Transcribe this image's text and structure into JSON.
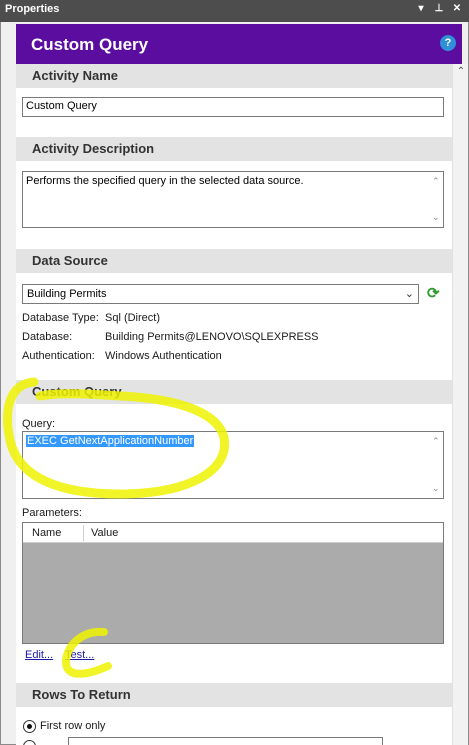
{
  "pane": {
    "title": "Properties",
    "controls": [
      "▾",
      "ᵖ",
      "✕"
    ]
  },
  "header": {
    "title": "Custom Query",
    "help_icon": "?"
  },
  "sections": {
    "activity_name": {
      "heading": "Activity Name",
      "value": "Custom Query"
    },
    "activity_description": {
      "heading": "Activity Description",
      "value": "Performs the specified query in the selected data source."
    },
    "data_source": {
      "heading": "Data Source",
      "selected": "Building Permits",
      "details": [
        {
          "key": "Database Type:",
          "value": "Sql (Direct)"
        },
        {
          "key": "Database:",
          "value": "Building Permits@LENOVO\\SQLEXPRESS"
        },
        {
          "key": "Authentication:",
          "value": "Windows Authentication"
        }
      ]
    },
    "custom_query": {
      "heading": "Custom Query",
      "query_label": "Query:",
      "query_text": "EXEC GetNextApplicationNumber",
      "parameters_label": "Parameters:",
      "columns": [
        "Name",
        "Value"
      ],
      "edit_link": "Edit...",
      "test_link": "Test..."
    },
    "rows_to_return": {
      "heading": "Rows To Return",
      "option_first": "First row only"
    }
  },
  "colors": {
    "header_purple": "#5a0d9e",
    "highlight_yellow": "#eef200",
    "selection_blue": "#3399ff"
  }
}
